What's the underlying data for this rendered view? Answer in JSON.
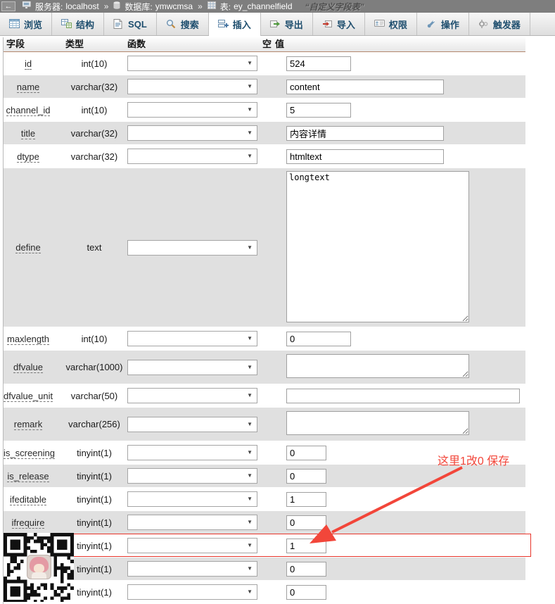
{
  "titlebar": {
    "back_arrow": "←",
    "separator": "»",
    "server_label": "服务器:",
    "server_value": "localhost",
    "db_label": "数据库:",
    "db_value": "ymwcmsa",
    "table_label": "表:",
    "table_value": "ey_channelfield",
    "table_comment": "“自定义字段表”"
  },
  "tabs": [
    {
      "id": "browse",
      "label": "浏览",
      "icon": "table-grid-icon",
      "active": false
    },
    {
      "id": "structure",
      "label": "结构",
      "icon": "structure-icon",
      "active": false
    },
    {
      "id": "sql",
      "label": "SQL",
      "icon": "sql-page-icon",
      "active": false
    },
    {
      "id": "search",
      "label": "搜索",
      "icon": "search-icon",
      "active": false
    },
    {
      "id": "insert",
      "label": "插入",
      "icon": "insert-icon",
      "active": true
    },
    {
      "id": "export",
      "label": "导出",
      "icon": "export-icon",
      "active": false
    },
    {
      "id": "import",
      "label": "导入",
      "icon": "import-icon",
      "active": false
    },
    {
      "id": "privileges",
      "label": "权限",
      "icon": "privileges-icon",
      "active": false
    },
    {
      "id": "operations",
      "label": "操作",
      "icon": "wrench-icon",
      "active": false
    },
    {
      "id": "triggers",
      "label": "触发器",
      "icon": "gear-icon",
      "active": false
    }
  ],
  "form": {
    "headers": {
      "field": "字段",
      "type": "类型",
      "function": "函数",
      "null": "空",
      "value": "值"
    },
    "rows": [
      {
        "field": "id",
        "type": "int(10)",
        "value": "524",
        "widget": "input",
        "size": "small"
      },
      {
        "field": "name",
        "type": "varchar(32)",
        "value": "content",
        "widget": "input",
        "size": "medium"
      },
      {
        "field": "channel_id",
        "type": "int(10)",
        "value": "5",
        "widget": "input",
        "size": "small"
      },
      {
        "field": "title",
        "type": "varchar(32)",
        "value": "内容详情",
        "widget": "input",
        "size": "medium"
      },
      {
        "field": "dtype",
        "type": "varchar(32)",
        "value": "htmltext",
        "widget": "input",
        "size": "medium"
      },
      {
        "field": "define",
        "type": "text",
        "value": "longtext",
        "widget": "textarea",
        "size": "large"
      },
      {
        "field": "maxlength",
        "type": "int(10)",
        "value": "0",
        "widget": "input",
        "size": "small"
      },
      {
        "field": "dfvalue",
        "type": "varchar(1000)",
        "value": "",
        "widget": "textarea",
        "size": "small"
      },
      {
        "field": "dfvalue_unit",
        "type": "varchar(50)",
        "value": "",
        "widget": "input",
        "size": "wide"
      },
      {
        "field": "remark",
        "type": "varchar(256)",
        "value": "",
        "widget": "textarea",
        "size": "small"
      },
      {
        "field": "is_screening",
        "type": "tinyint(1)",
        "value": "0",
        "widget": "input",
        "size": "tiny"
      },
      {
        "field": "is_release",
        "type": "tinyint(1)",
        "value": "0",
        "widget": "input",
        "size": "tiny"
      },
      {
        "field": "ifeditable",
        "type": "tinyint(1)",
        "value": "1",
        "widget": "input",
        "size": "tiny"
      },
      {
        "field": "ifrequire",
        "type": "tinyint(1)",
        "value": "0",
        "widget": "input",
        "size": "tiny"
      },
      {
        "field": "",
        "type": "tinyint(1)",
        "value": "1",
        "widget": "input",
        "size": "tiny",
        "highlighted": true
      },
      {
        "field": "",
        "type": "tinyint(1)",
        "value": "0",
        "widget": "input",
        "size": "tiny"
      },
      {
        "field": "",
        "type": "tinyint(1)",
        "value": "0",
        "widget": "input",
        "size": "tiny"
      }
    ]
  },
  "annotation": {
    "text": "这里1改0 保存"
  },
  "colors": {
    "accent_red": "#f2463a",
    "highlight_border": "#e8342a",
    "tab_text": "#1e4e6e",
    "titlebar_bg": "#7e7e7e",
    "row_alt": "#e0e0e0"
  }
}
